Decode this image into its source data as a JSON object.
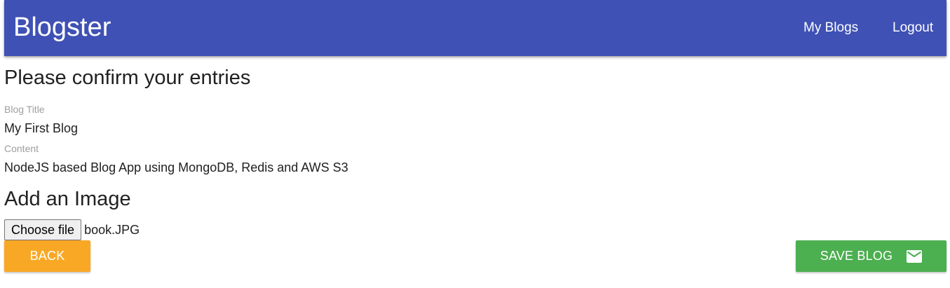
{
  "header": {
    "brand": "Blogster",
    "nav": {
      "my_blogs": "My Blogs",
      "logout": "Logout"
    },
    "background_color": "#3f51b5"
  },
  "form_review": {
    "heading": "Please confirm your entries",
    "fields": [
      {
        "label": "Blog Title",
        "value": "My First Blog"
      },
      {
        "label": "Content",
        "value": "NodeJS based Blog App using MongoDB, Redis and AWS S3"
      }
    ]
  },
  "image_upload": {
    "heading": "Add an Image",
    "choose_file_label": "Choose file",
    "file_name": "book.JPG"
  },
  "actions": {
    "back_label": "BACK",
    "back_color": "#f9a825",
    "save_label": "SAVE BLOG",
    "save_color": "#4caf50",
    "save_icon": "mail-icon"
  }
}
